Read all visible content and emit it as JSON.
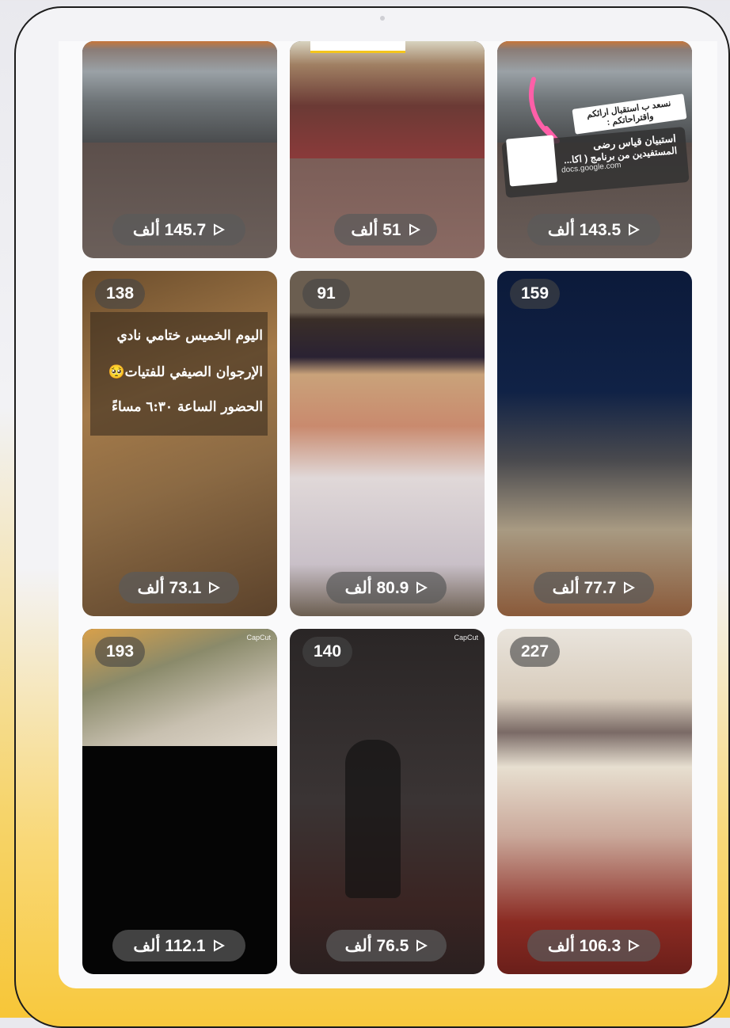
{
  "tiles": [
    {
      "views": "145.7 ألف",
      "count": ""
    },
    {
      "views": "51 ألف",
      "count": ""
    },
    {
      "views": "143.5 ألف",
      "count": ""
    },
    {
      "views": "73.1 ألف",
      "count": "138"
    },
    {
      "views": "80.9 ألف",
      "count": "91"
    },
    {
      "views": "77.7 ألف",
      "count": "159"
    },
    {
      "views": "112.1 ألف",
      "count": "193"
    },
    {
      "views": "76.5 ألف",
      "count": "140"
    },
    {
      "views": "106.3 ألف",
      "count": "227"
    }
  ],
  "story_overlay": {
    "line1": "اليوم الخميس ختامي نادي",
    "line2": "الإرجوان الصيفي للفتيات🥺",
    "line3": "الحضور الساعة ٦:٣٠ مساءً"
  },
  "survey_sticker": {
    "title": "نسعد ب استقبال ارائكم واقتراحاتكم :",
    "text1": "استبيان قياس رضى",
    "text2": "المستفيدين من برنامج ( اكا...",
    "domain": "docs.google.com"
  },
  "watermark": "CapCut",
  "icons": {
    "play": "play-icon"
  },
  "colors": {
    "accent": "#f7c638",
    "pink": "#ff5fa8"
  }
}
